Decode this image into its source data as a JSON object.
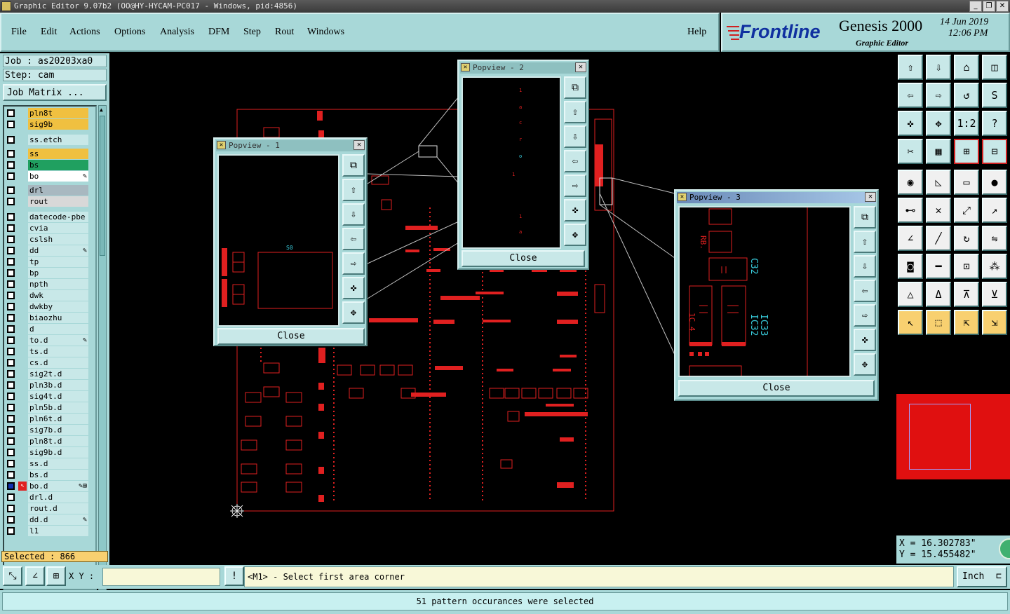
{
  "window": {
    "title": "Graphic Editor 9.07b2 (OO@HY-HYCAM-PC017 - Windows, pid:4856)",
    "min": "_",
    "max": "❐",
    "close": "✕"
  },
  "menu": [
    "File",
    "Edit",
    "Actions",
    "Options",
    "Analysis",
    "DFM",
    "Step",
    "Rout",
    "Windows"
  ],
  "help": "Help",
  "brand": {
    "logo": "Frontline",
    "product": "Genesis 2000",
    "subtitle": "Graphic Editor",
    "date": "14 Jun 2019",
    "time": "12:06 PM"
  },
  "job": {
    "job": "Job : as20203xa0",
    "step": "Step: cam",
    "matrix": "Job Matrix ..."
  },
  "layers": [
    {
      "name": "pln8t",
      "color": "#f0c040",
      "mark": ""
    },
    {
      "name": "sig9b",
      "color": "#f0c040",
      "mark": ""
    },
    {
      "name": "ss.etch",
      "color": "#c8e8e8",
      "mark": ""
    },
    {
      "name": "ss",
      "color": "#f0c040",
      "mark": ""
    },
    {
      "name": "bs",
      "color": "#20a060",
      "mark": ""
    },
    {
      "name": "bo",
      "color": "#ffffff",
      "mark": "✎"
    },
    {
      "name": "drl",
      "color": "#a8b8c0",
      "mark": ""
    },
    {
      "name": "rout",
      "color": "#d8d8d8",
      "mark": ""
    },
    {
      "name": "datecode-pbe",
      "color": "#c8e8e8",
      "mark": ""
    },
    {
      "name": "cvia",
      "color": "#c8e8e8",
      "mark": ""
    },
    {
      "name": "cslsh",
      "color": "#c8e8e8",
      "mark": ""
    },
    {
      "name": "dd",
      "color": "#c8e8e8",
      "mark": "✎"
    },
    {
      "name": "tp",
      "color": "#c8e8e8",
      "mark": ""
    },
    {
      "name": "bp",
      "color": "#c8e8e8",
      "mark": ""
    },
    {
      "name": "npth",
      "color": "#c8e8e8",
      "mark": ""
    },
    {
      "name": "dwk",
      "color": "#c8e8e8",
      "mark": ""
    },
    {
      "name": "dwkby",
      "color": "#c8e8e8",
      "mark": ""
    },
    {
      "name": "biaozhu",
      "color": "#c8e8e8",
      "mark": ""
    },
    {
      "name": "d",
      "color": "#c8e8e8",
      "mark": ""
    },
    {
      "name": "to.d",
      "color": "#c8e8e8",
      "mark": "✎"
    },
    {
      "name": "ts.d",
      "color": "#c8e8e8",
      "mark": ""
    },
    {
      "name": "cs.d",
      "color": "#c8e8e8",
      "mark": ""
    },
    {
      "name": "sig2t.d",
      "color": "#c8e8e8",
      "mark": ""
    },
    {
      "name": "pln3b.d",
      "color": "#c8e8e8",
      "mark": ""
    },
    {
      "name": "sig4t.d",
      "color": "#c8e8e8",
      "mark": ""
    },
    {
      "name": "pln5b.d",
      "color": "#c8e8e8",
      "mark": ""
    },
    {
      "name": "pln6t.d",
      "color": "#c8e8e8",
      "mark": ""
    },
    {
      "name": "sig7b.d",
      "color": "#c8e8e8",
      "mark": ""
    },
    {
      "name": "pln8t.d",
      "color": "#c8e8e8",
      "mark": ""
    },
    {
      "name": "sig9b.d",
      "color": "#c8e8e8",
      "mark": ""
    },
    {
      "name": "ss.d",
      "color": "#c8e8e8",
      "mark": ""
    },
    {
      "name": "bs.d",
      "color": "#c8e8e8",
      "mark": ""
    },
    {
      "name": "bo.d",
      "color": "#c8e8e8",
      "mark": "✎⊞"
    },
    {
      "name": "drl.d",
      "color": "#c8e8e8",
      "mark": ""
    },
    {
      "name": "rout.d",
      "color": "#c8e8e8",
      "mark": ""
    },
    {
      "name": "dd.d",
      "color": "#c8e8e8",
      "mark": "✎"
    },
    {
      "name": "l1",
      "color": "#c8e8e8",
      "mark": ""
    }
  ],
  "selected": "Selected : 866",
  "popups": [
    {
      "title": "Popview - 1",
      "close": "Close"
    },
    {
      "title": "Popview - 2",
      "close": "Close"
    },
    {
      "title": "Popview - 3",
      "close": "Close"
    }
  ],
  "popview3_labels": {
    "c32": "C32",
    "ic32": "IC32",
    "ic33": "IC33"
  },
  "coords": {
    "x": "X = 16.302783\"",
    "y": "Y = 15.455482\""
  },
  "status": {
    "xy_label": "X Y :",
    "xy_value": "",
    "prompt": "<M1> - Select first area corner",
    "unit": "Inch"
  },
  "message": "51 pattern occurances were selected"
}
